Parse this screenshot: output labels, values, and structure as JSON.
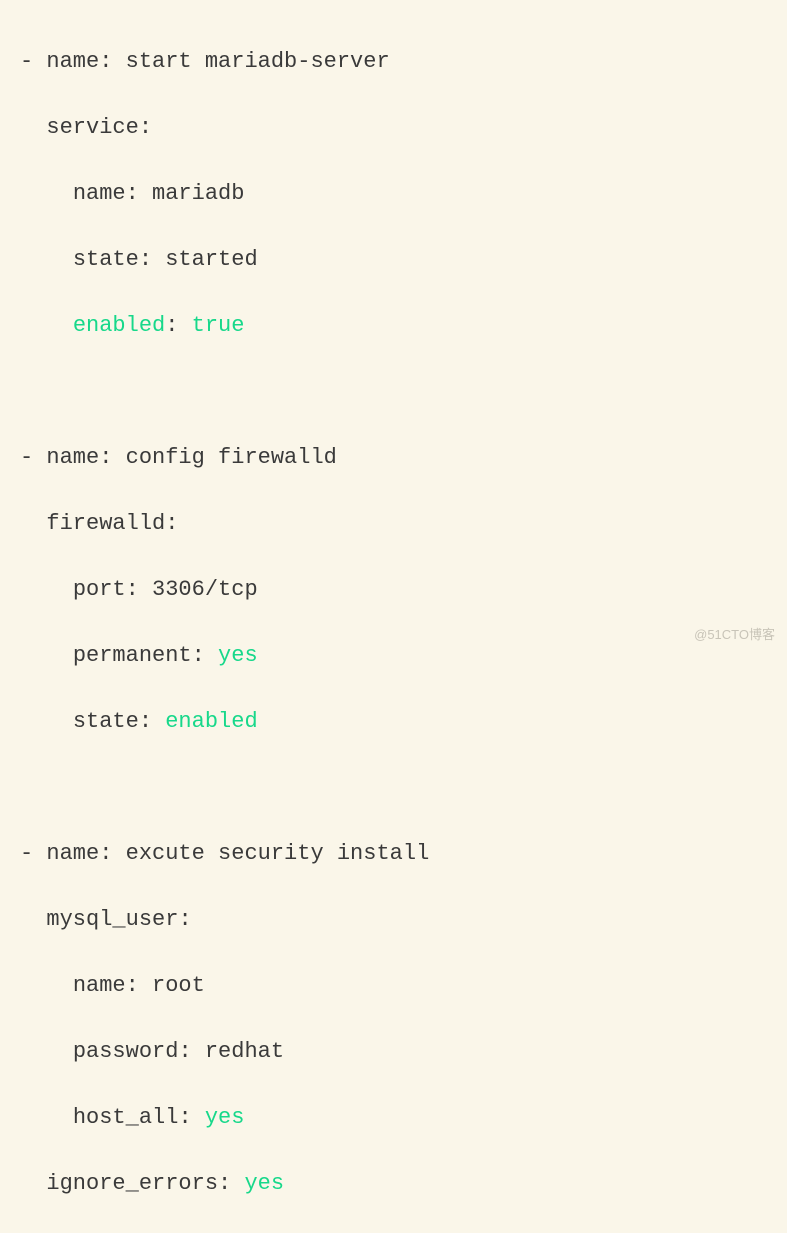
{
  "tasks": [
    {
      "dash": "-",
      "name_key": "name",
      "name_value": "start mariadb-server",
      "module": "service",
      "params": [
        {
          "key": "name",
          "value": "mariadb",
          "key_highlight": false,
          "value_highlight": false
        },
        {
          "key": "enabled",
          "value": "true",
          "key_highlight": true,
          "value_highlight": true
        }
      ],
      "params_middle": [
        {
          "key": "state",
          "value": "started",
          "key_highlight": false,
          "value_highlight": false
        }
      ]
    },
    {
      "dash": "-",
      "name_key": "name",
      "name_value": "config firewalld",
      "module": "firewalld",
      "params": [
        {
          "key": "port",
          "value": "3306/tcp",
          "key_highlight": false,
          "value_highlight": false
        },
        {
          "key": "permanent",
          "value": "yes",
          "key_highlight": false,
          "value_highlight": true
        },
        {
          "key": "state",
          "value": "enabled",
          "key_highlight": false,
          "value_highlight": true
        }
      ]
    },
    {
      "dash": "-",
      "name_key": "name",
      "name_value": "excute security install",
      "module": "mysql_user",
      "params": [
        {
          "key": "name",
          "value": "root",
          "key_highlight": false,
          "value_highlight": false
        },
        {
          "key": "password",
          "value": "redhat",
          "key_highlight": false,
          "value_highlight": false
        },
        {
          "key": "host_all",
          "value": "yes",
          "key_highlight": false,
          "value_highlight": true
        }
      ],
      "extra_line": {
        "key": "ignore_errors",
        "value": "yes",
        "value_highlight": true
      }
    }
  ],
  "watermark": "@51CTO博客"
}
